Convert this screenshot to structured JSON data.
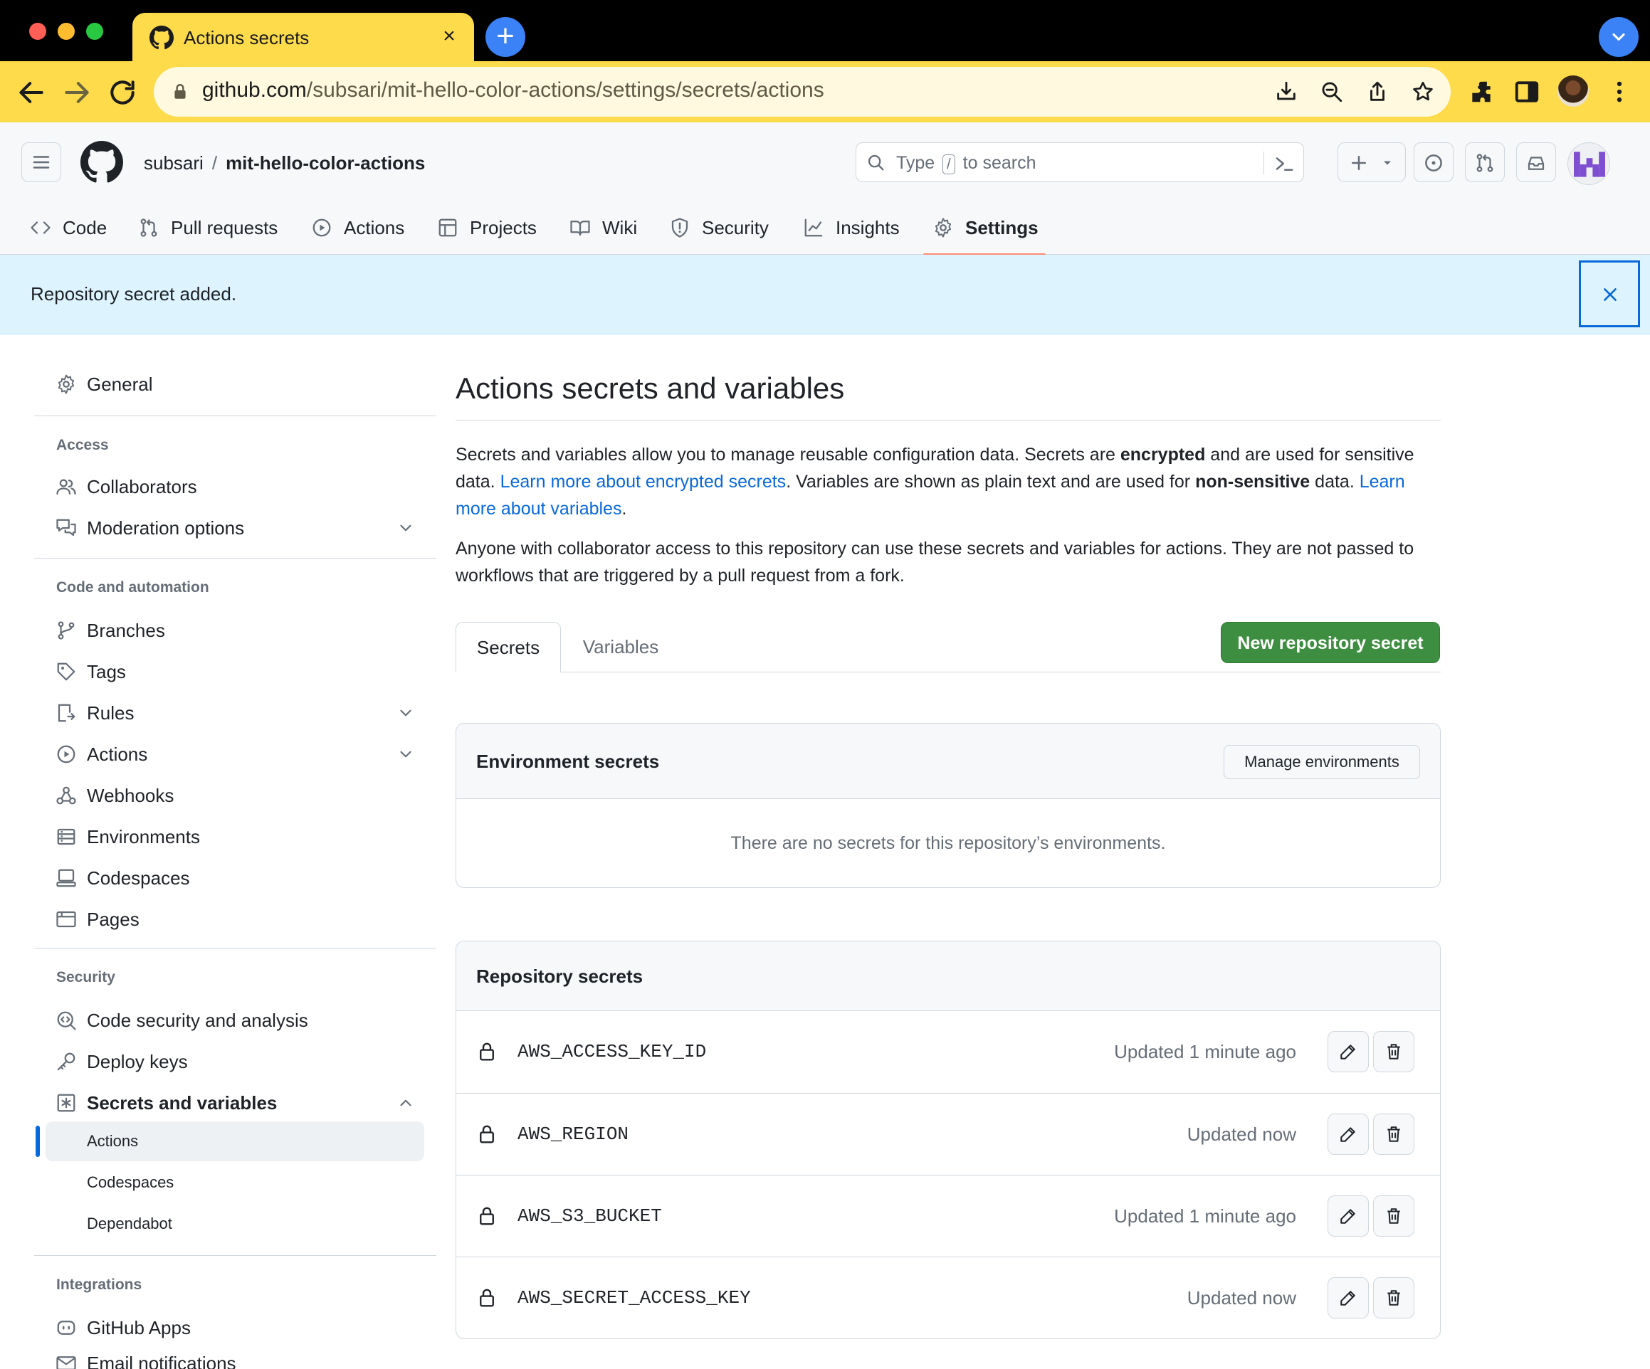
{
  "browser": {
    "tab_title": "Actions secrets",
    "url_host": "github.com",
    "url_path": "/subsari/mit-hello-color-actions/settings/secrets/actions"
  },
  "header": {
    "owner": "subsari",
    "separator": "/",
    "repo": "mit-hello-color-actions",
    "search_type": "Type",
    "search_key": "/",
    "search_rest": "to search"
  },
  "repo_nav": [
    {
      "label": "Code",
      "icon": "code-icon"
    },
    {
      "label": "Pull requests",
      "icon": "pull-request-icon"
    },
    {
      "label": "Actions",
      "icon": "play-icon"
    },
    {
      "label": "Projects",
      "icon": "table-icon"
    },
    {
      "label": "Wiki",
      "icon": "book-icon"
    },
    {
      "label": "Security",
      "icon": "shield-icon"
    },
    {
      "label": "Insights",
      "icon": "graph-icon"
    },
    {
      "label": "Settings",
      "icon": "gear-icon",
      "active": true
    }
  ],
  "flash": {
    "message": "Repository secret added."
  },
  "sidebar": {
    "general": "General",
    "access_heading": "Access",
    "collaborators": "Collaborators",
    "moderation": "Moderation options",
    "code_heading": "Code and automation",
    "branches": "Branches",
    "tags": "Tags",
    "rules": "Rules",
    "actions": "Actions",
    "webhooks": "Webhooks",
    "environments": "Environments",
    "codespaces": "Codespaces",
    "pages": "Pages",
    "security_heading": "Security",
    "code_security": "Code security and analysis",
    "deploy_keys": "Deploy keys",
    "secrets_vars": "Secrets and variables",
    "sub_actions": "Actions",
    "sub_codespaces": "Codespaces",
    "sub_dependabot": "Dependabot",
    "integrations_heading": "Integrations",
    "github_apps": "GitHub Apps",
    "email_notifications": "Email notifications"
  },
  "main": {
    "title": "Actions secrets and variables",
    "p1_a": "Secrets and variables allow you to manage reusable configuration data. Secrets are ",
    "p1_b": "encrypted",
    "p1_c": " and are used for sensitive data. ",
    "p1_link1": "Learn more about encrypted secrets",
    "p1_d": ". Variables are shown as plain text and are used for ",
    "p1_e": "non-sensitive",
    "p1_f": " data. ",
    "p1_link2": "Learn more about variables",
    "p1_g": ".",
    "p2": "Anyone with collaborator access to this repository can use these secrets and variables for actions. They are not passed to workflows that are triggered by a pull request from a fork.",
    "tab_secrets": "Secrets",
    "tab_variables": "Variables",
    "new_secret_button": "New repository secret"
  },
  "env_secrets": {
    "title": "Environment secrets",
    "manage_button": "Manage environments",
    "empty": "There are no secrets for this repository’s environments."
  },
  "repo_secrets": {
    "title": "Repository secrets",
    "rows": [
      {
        "name": "AWS_ACCESS_KEY_ID",
        "updated": "Updated 1 minute ago"
      },
      {
        "name": "AWS_REGION",
        "updated": "Updated now"
      },
      {
        "name": "AWS_S3_BUCKET",
        "updated": "Updated 1 minute ago"
      },
      {
        "name": "AWS_SECRET_ACCESS_KEY",
        "updated": "Updated now"
      }
    ]
  },
  "colors": {
    "chrome_tab": "#fedb4a",
    "primary_button": "#3e8e41",
    "link": "#0969da",
    "flash_bg": "#ddf4ff",
    "active_tab_underline": "#fd8c73"
  }
}
